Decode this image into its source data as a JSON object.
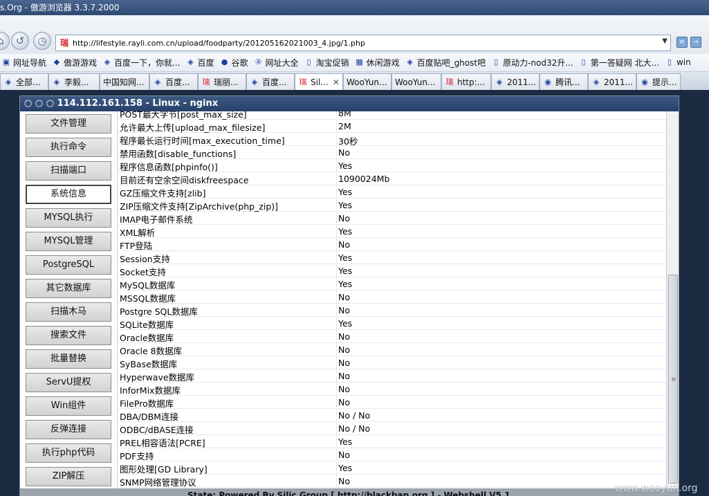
{
  "window": {
    "title": "s.Org - 傲游浏览器 3.3.7.2000"
  },
  "address_bar": {
    "url": "http://lifestyle.rayli.com.cn/upload/foodparty/201205162021003_4.jpg/1.php"
  },
  "bookmarks": [
    "网址导航",
    "傲游游戏",
    "百度一下，你就...",
    "百度",
    "谷歌",
    "网址大全",
    "淘宝促销",
    "休闲游戏",
    "百度贴吧_ghost吧",
    "原动力-nod32升...",
    "第一答疑网 北大...",
    "win"
  ],
  "tabs": [
    {
      "label": "全部..."
    },
    {
      "label": "李毅..."
    },
    {
      "label": "中国知网..."
    },
    {
      "label": "百度..."
    },
    {
      "label": "瑞丽..."
    },
    {
      "label": "百度..."
    },
    {
      "label": "Sil..."
    },
    {
      "label": "WooYun..."
    },
    {
      "label": "WooYun..."
    },
    {
      "label": "http:..."
    },
    {
      "label": "2011..."
    },
    {
      "label": "腾讯..."
    },
    {
      "label": "2011..."
    },
    {
      "label": "提示..."
    }
  ],
  "shell": {
    "header": "○ ○ ○ 114.112.161.158 - Linux - nginx",
    "status": "State: Powered By Silic Group [ http://blackbap.org ] - Webshell V5.1"
  },
  "sidebar": [
    "文件管理",
    "执行命令",
    "扫描端口",
    "系统信息",
    "MYSQL执行",
    "MYSQL管理",
    "PostgreSQL",
    "其它数据库",
    "扫描木马",
    "搜索文件",
    "批量替换",
    "ServU提权",
    "Win组件",
    "反弹连接",
    "执行php代码",
    "ZIP解压"
  ],
  "sidebar_active": "系统信息",
  "info_rows": [
    {
      "key": "POST最大字节[post_max_size]",
      "value": "8M"
    },
    {
      "key": "允许最大上传[upload_max_filesize]",
      "value": "2M"
    },
    {
      "key": "程序最长运行时间[max_execution_time]",
      "value": "30秒"
    },
    {
      "key": "禁用函数[disable_functions]",
      "value": "No"
    },
    {
      "key": "程序信息函数[phpinfo()]",
      "value": "Yes"
    },
    {
      "key": "目前还有空余空间diskfreespace",
      "value": "1090024Mb"
    },
    {
      "key": "GZ压缩文件支持[zlib]",
      "value": "Yes"
    },
    {
      "key": "ZIP压缩文件支持[ZipArchive(php_zip)]",
      "value": "Yes"
    },
    {
      "key": "IMAP电子邮件系统",
      "value": "No"
    },
    {
      "key": "XML解析",
      "value": "Yes"
    },
    {
      "key": "FTP登陆",
      "value": "No"
    },
    {
      "key": "Session支持",
      "value": "Yes"
    },
    {
      "key": "Socket支持",
      "value": "Yes"
    },
    {
      "key": "MySQL数据库",
      "value": "Yes"
    },
    {
      "key": "MSSQL数据库",
      "value": "No"
    },
    {
      "key": "Postgre SQL数据库",
      "value": "No"
    },
    {
      "key": "SQLite数据库",
      "value": "Yes"
    },
    {
      "key": "Oracle数据库",
      "value": "No"
    },
    {
      "key": "Oracle 8数据库",
      "value": "No"
    },
    {
      "key": "SyBase数据库",
      "value": "No"
    },
    {
      "key": "Hyperwave数据库",
      "value": "No"
    },
    {
      "key": "InforMix数据库",
      "value": "No"
    },
    {
      "key": "FilePro数据库",
      "value": "No"
    },
    {
      "key": "DBA/DBM连接",
      "value": "No / No"
    },
    {
      "key": "ODBC/dBASE连接",
      "value": "No / No"
    },
    {
      "key": "PREL相容语法[PCRE]",
      "value": "Yes"
    },
    {
      "key": "PDF支持",
      "value": "No"
    },
    {
      "key": "图形处理[GD Library]",
      "value": "Yes"
    },
    {
      "key": "SNMP网络管理协议",
      "value": "No"
    }
  ],
  "watermark": "www.wooyun.org"
}
